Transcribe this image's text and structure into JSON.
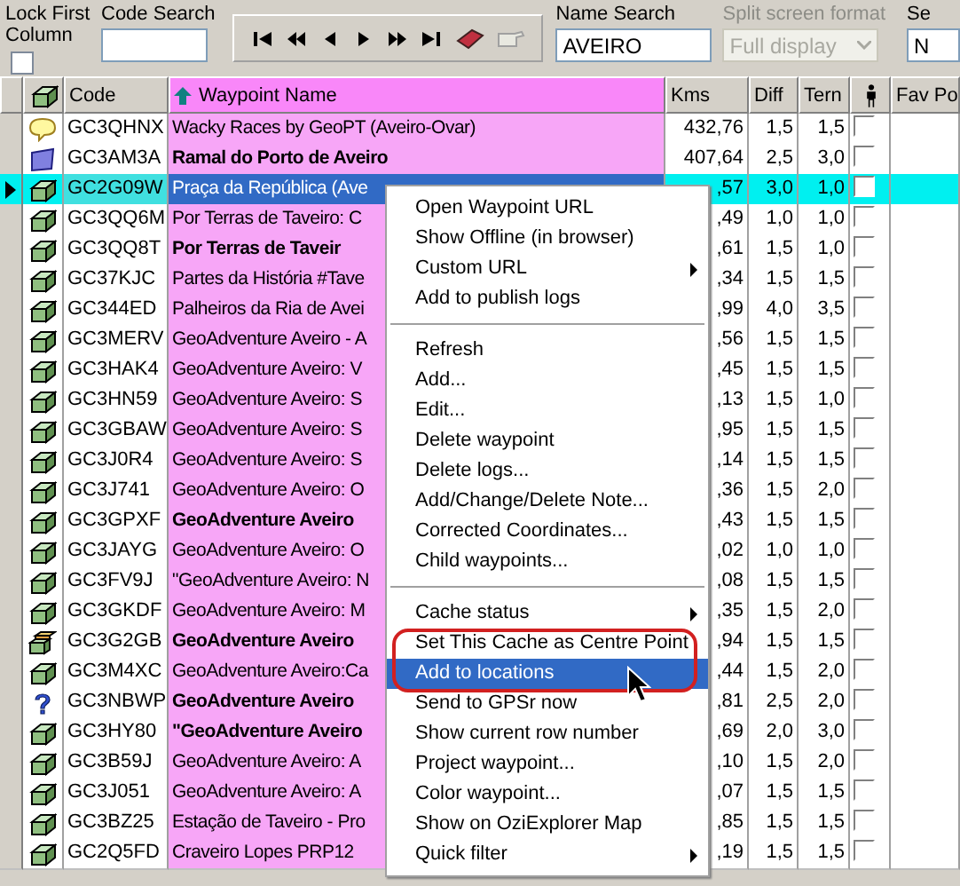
{
  "toolbar": {
    "lock_first_column": {
      "label": "Lock First Column",
      "checked": false
    },
    "code_search": {
      "label": "Code Search"
    },
    "name_search": {
      "label": "Name Search",
      "value": "AVEIRO"
    },
    "split_screen": {
      "label": "Split screen format",
      "value": "Full display",
      "disabled": true
    },
    "cut_field": {
      "label": "Se",
      "value": "N"
    }
  },
  "columns": [
    {
      "label": "Code",
      "sorted": false
    },
    {
      "label": "Waypoint Name",
      "sorted": true
    },
    {
      "label": "Kms",
      "sorted": false
    },
    {
      "label": "Diff",
      "sorted": false
    },
    {
      "label": "Tern",
      "sorted": false
    },
    {
      "label": "Fav Po",
      "sorted": false
    }
  ],
  "rows": [
    {
      "kind": "bubble",
      "code": "GC3QHNX",
      "name": "Wacky Races by GeoPT (Aveiro-Ovar)",
      "bold": false,
      "kms": "432,76",
      "diff": "1,5",
      "tern": "1,5",
      "checked": false,
      "selected": false
    },
    {
      "kind": "flag",
      "code": "GC3AM3A",
      "name": "Ramal do Porto de Aveiro",
      "bold": true,
      "kms": "407,64",
      "diff": "2,5",
      "tern": "3,0",
      "checked": false,
      "selected": false
    },
    {
      "kind": "box",
      "code": "GC2G09W",
      "name": "Praça da República (Ave",
      "bold": false,
      "kms": ",57",
      "diff": "3,0",
      "tern": "1,0",
      "checked": false,
      "selected": true
    },
    {
      "kind": "box",
      "code": "GC3QQ6M",
      "name": "Por Terras de Taveiro: C",
      "bold": false,
      "kms": ",49",
      "diff": "1,0",
      "tern": "1,0",
      "checked": false,
      "selected": false
    },
    {
      "kind": "box",
      "code": "GC3QQ8T",
      "name": "Por Terras de Taveir",
      "bold": true,
      "kms": ",61",
      "diff": "1,5",
      "tern": "1,0",
      "checked": false,
      "selected": false
    },
    {
      "kind": "box",
      "code": "GC37KJC",
      "name": "Partes da História #Tave",
      "bold": false,
      "kms": ",34",
      "diff": "1,5",
      "tern": "1,5",
      "checked": false,
      "selected": false
    },
    {
      "kind": "box",
      "code": "GC344ED",
      "name": "Palheiros da Ria de Avei",
      "bold": false,
      "kms": ",99",
      "diff": "4,0",
      "tern": "3,5",
      "checked": false,
      "selected": false
    },
    {
      "kind": "box",
      "code": "GC3MERV",
      "name": "GeoAdventure Aveiro - A",
      "bold": false,
      "kms": ",56",
      "diff": "1,5",
      "tern": "1,5",
      "checked": false,
      "selected": false
    },
    {
      "kind": "box",
      "code": "GC3HAK4",
      "name": "GeoAdventure Aveiro: V",
      "bold": false,
      "kms": ",45",
      "diff": "1,5",
      "tern": "1,5",
      "checked": false,
      "selected": false
    },
    {
      "kind": "box",
      "code": "GC3HN59",
      "name": "GeoAdventure Aveiro: S",
      "bold": false,
      "kms": ",13",
      "diff": "1,5",
      "tern": "1,0",
      "checked": false,
      "selected": false
    },
    {
      "kind": "box",
      "code": "GC3GBAW",
      "name": "GeoAdventure Aveiro: S",
      "bold": false,
      "kms": ",95",
      "diff": "1,5",
      "tern": "1,5",
      "checked": false,
      "selected": false
    },
    {
      "kind": "box",
      "code": "GC3J0R4",
      "name": "GeoAdventure Aveiro: S",
      "bold": false,
      "kms": ",14",
      "diff": "1,5",
      "tern": "1,5",
      "checked": false,
      "selected": false
    },
    {
      "kind": "box",
      "code": "GC3J741",
      "name": "GeoAdventure Aveiro: O",
      "bold": false,
      "kms": ",36",
      "diff": "1,5",
      "tern": "2,0",
      "checked": false,
      "selected": false
    },
    {
      "kind": "box",
      "code": "GC3GPXF",
      "name": "GeoAdventure Aveiro",
      "bold": true,
      "kms": ",43",
      "diff": "1,5",
      "tern": "1,5",
      "checked": false,
      "selected": false
    },
    {
      "kind": "box",
      "code": "GC3JAYG",
      "name": "GeoAdventure Aveiro: O",
      "bold": false,
      "kms": ",02",
      "diff": "1,0",
      "tern": "1,0",
      "checked": false,
      "selected": false
    },
    {
      "kind": "box",
      "code": "GC3FV9J",
      "name": "\"GeoAdventure Aveiro: N",
      "bold": false,
      "kms": ",08",
      "diff": "1,5",
      "tern": "1,5",
      "checked": false,
      "selected": false
    },
    {
      "kind": "box",
      "code": "GC3GKDF",
      "name": "GeoAdventure Aveiro: M",
      "bold": false,
      "kms": ",35",
      "diff": "1,5",
      "tern": "2,0",
      "checked": false,
      "selected": false
    },
    {
      "kind": "stack",
      "code": "GC3G2GB",
      "name": "GeoAdventure Aveiro",
      "bold": true,
      "kms": ",94",
      "diff": "1,5",
      "tern": "1,5",
      "checked": false,
      "selected": false
    },
    {
      "kind": "box",
      "code": "GC3M4XC",
      "name": "GeoAdventure Aveiro:Ca",
      "bold": false,
      "kms": ",44",
      "diff": "1,5",
      "tern": "2,0",
      "checked": false,
      "selected": false
    },
    {
      "kind": "question",
      "code": "GC3NBWP",
      "name": "GeoAdventure Aveiro",
      "bold": true,
      "kms": ",81",
      "diff": "2,5",
      "tern": "2,0",
      "checked": false,
      "selected": false
    },
    {
      "kind": "box",
      "code": "GC3HY80",
      "name": "\"GeoAdventure Aveiro",
      "bold": true,
      "kms": ",69",
      "diff": "2,0",
      "tern": "3,0",
      "checked": false,
      "selected": false
    },
    {
      "kind": "box",
      "code": "GC3B59J",
      "name": "GeoAdventure Aveiro: A",
      "bold": false,
      "kms": ",10",
      "diff": "1,5",
      "tern": "2,0",
      "checked": false,
      "selected": false
    },
    {
      "kind": "box",
      "code": "GC3J051",
      "name": "GeoAdventure Aveiro: A",
      "bold": false,
      "kms": ",07",
      "diff": "1,5",
      "tern": "1,5",
      "checked": false,
      "selected": false
    },
    {
      "kind": "box",
      "code": "GC3BZ25",
      "name": "Estação de Taveiro - Pro",
      "bold": false,
      "kms": ",85",
      "diff": "1,5",
      "tern": "1,5",
      "checked": false,
      "selected": false
    },
    {
      "kind": "box",
      "code": "GC2Q5FD",
      "name": "Craveiro Lopes PRP12",
      "bold": false,
      "kms": ",19",
      "diff": "1,5",
      "tern": "1,5",
      "checked": false,
      "selected": false
    }
  ],
  "context_menu": [
    {
      "kind": "item",
      "label": "Open Waypoint URL",
      "submenu": false,
      "selected": false
    },
    {
      "kind": "item",
      "label": "Show Offline (in browser)",
      "submenu": false,
      "selected": false
    },
    {
      "kind": "item",
      "label": "Custom URL",
      "submenu": true,
      "selected": false
    },
    {
      "kind": "item",
      "label": "Add to publish logs",
      "submenu": false,
      "selected": false
    },
    {
      "kind": "separator"
    },
    {
      "kind": "item",
      "label": "Refresh",
      "submenu": false,
      "selected": false
    },
    {
      "kind": "item",
      "label": "Add...",
      "submenu": false,
      "selected": false
    },
    {
      "kind": "item",
      "label": "Edit...",
      "submenu": false,
      "selected": false
    },
    {
      "kind": "item",
      "label": "Delete waypoint",
      "submenu": false,
      "selected": false
    },
    {
      "kind": "item",
      "label": "Delete logs...",
      "submenu": false,
      "selected": false
    },
    {
      "kind": "item",
      "label": "Add/Change/Delete Note...",
      "submenu": false,
      "selected": false
    },
    {
      "kind": "item",
      "label": "Corrected Coordinates...",
      "submenu": false,
      "selected": false
    },
    {
      "kind": "item",
      "label": "Child waypoints...",
      "submenu": false,
      "selected": false
    },
    {
      "kind": "separator"
    },
    {
      "kind": "item",
      "label": "Cache status",
      "submenu": true,
      "selected": false
    },
    {
      "kind": "item",
      "label": "Set This Cache as Centre Point",
      "submenu": false,
      "selected": false
    },
    {
      "kind": "item",
      "label": "Add to locations",
      "submenu": false,
      "selected": true
    },
    {
      "kind": "item",
      "label": "Send to GPSr now",
      "submenu": false,
      "selected": false
    },
    {
      "kind": "item",
      "label": "Show current row number",
      "submenu": false,
      "selected": false
    },
    {
      "kind": "item",
      "label": "Project waypoint...",
      "submenu": false,
      "selected": false
    },
    {
      "kind": "item",
      "label": "Color waypoint...",
      "submenu": false,
      "selected": false
    },
    {
      "kind": "item",
      "label": "Show on OziExplorer Map",
      "submenu": false,
      "selected": false
    },
    {
      "kind": "item",
      "label": "Quick filter",
      "submenu": true,
      "selected": false
    }
  ]
}
